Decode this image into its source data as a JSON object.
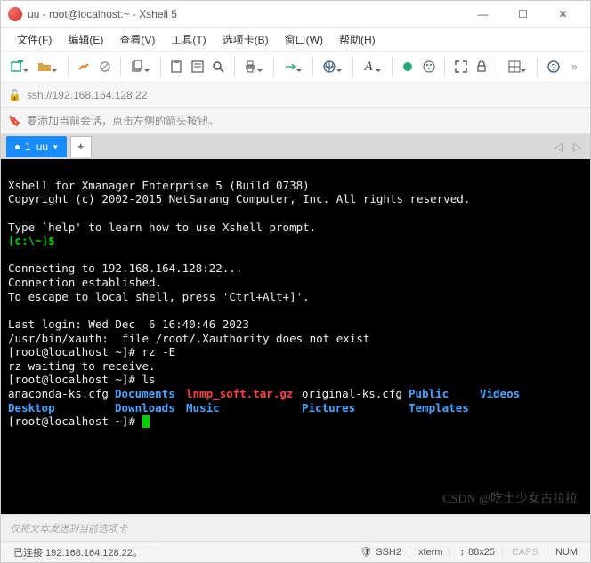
{
  "window": {
    "title": "uu - root@localhost:~ - Xshell 5",
    "min": "—",
    "max": "☐",
    "close": "✕"
  },
  "menu": {
    "file": "文件(F)",
    "edit": "编辑(E)",
    "view": "查看(V)",
    "tools": "工具(T)",
    "options": "选项卡(B)",
    "window": "窗口(W)",
    "help": "帮助(H)"
  },
  "address": {
    "url": "ssh://192.168.164.128:22"
  },
  "hint": {
    "text": "要添加当前会话，点击左侧的箭头按钮。"
  },
  "tabs": {
    "active_index": "1",
    "active_label": "uu",
    "add": "+"
  },
  "terminal": {
    "banner1": "Xshell for Xmanager Enterprise 5 (Build 0738)",
    "banner2": "Copyright (c) 2002-2015 NetSarang Computer, Inc. All rights reserved.",
    "typehelp": "Type `help' to learn how to use Xshell prompt.",
    "localprompt": "[c:\\~]$",
    "connecting": "Connecting to 192.168.164.128:22...",
    "established": "Connection established.",
    "escape": "To escape to local shell, press 'Ctrl+Alt+]'.",
    "lastlogin": "Last login: Wed Dec  6 16:40:46 2023",
    "xauth": "/usr/bin/xauth:  file /root/.Xauthority does not exist",
    "prompt1": "[root@localhost ~]# ",
    "cmd1": "rz -E",
    "rzwait": "rz waiting to receive.",
    "prompt2": "[root@localhost ~]# ",
    "cmd2": "ls",
    "ls_row1": {
      "c1": "anaconda-ks.cfg",
      "c2": "Documents",
      "c3": "lnmp_soft.tar.gz",
      "c4": "original-ks.cfg",
      "c5": "Public",
      "c6": "Videos"
    },
    "ls_row2": {
      "c1": "Desktop",
      "c2": "Downloads",
      "c3": "Music",
      "c4": "Pictures",
      "c5": "Templates"
    },
    "prompt3": "[root@localhost ~]# "
  },
  "compose": "仅将文本发送到当前选项卡",
  "status": {
    "connected": "已连接 192.168.164.128:22。",
    "ssh": "SSH2",
    "term": "xterm",
    "size": "88x25",
    "caps": "CAPS",
    "num": "NUM"
  },
  "watermark": "CSDN @吃土少女古拉拉"
}
